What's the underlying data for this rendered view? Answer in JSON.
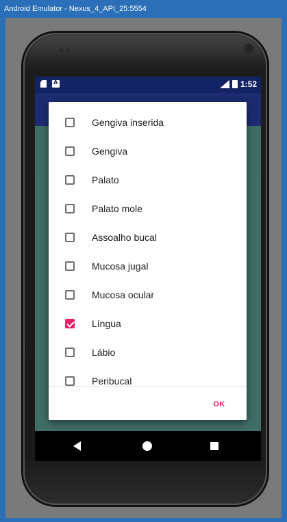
{
  "window": {
    "title": "Android Emulator - Nexus_4_API_25:5554"
  },
  "status_bar": {
    "time": "1:52",
    "network": "4G"
  },
  "dialog": {
    "items": [
      {
        "label": "Gengiva inserida",
        "checked": false
      },
      {
        "label": "Gengiva",
        "checked": false
      },
      {
        "label": "Palato",
        "checked": false
      },
      {
        "label": "Palato mole",
        "checked": false
      },
      {
        "label": "Assoalho bucal",
        "checked": false
      },
      {
        "label": "Mucosa jugal",
        "checked": false
      },
      {
        "label": "Mucosa ocular",
        "checked": false
      },
      {
        "label": "Língua",
        "checked": true
      },
      {
        "label": "Lábio",
        "checked": false
      },
      {
        "label": "Peribucal",
        "checked": false
      }
    ],
    "ok_label": "OK"
  },
  "colors": {
    "accent": "#e91e63",
    "status_bar": "#142363",
    "app_bar": "#1d2b70",
    "window_chrome": "#2a6fb8"
  },
  "icons": {
    "status_left": [
      "sd-card-icon",
      "notification-icon"
    ],
    "status_right": [
      "signal-icon",
      "battery-icon"
    ],
    "navigation": [
      "back-icon",
      "home-icon",
      "recents-icon"
    ]
  }
}
